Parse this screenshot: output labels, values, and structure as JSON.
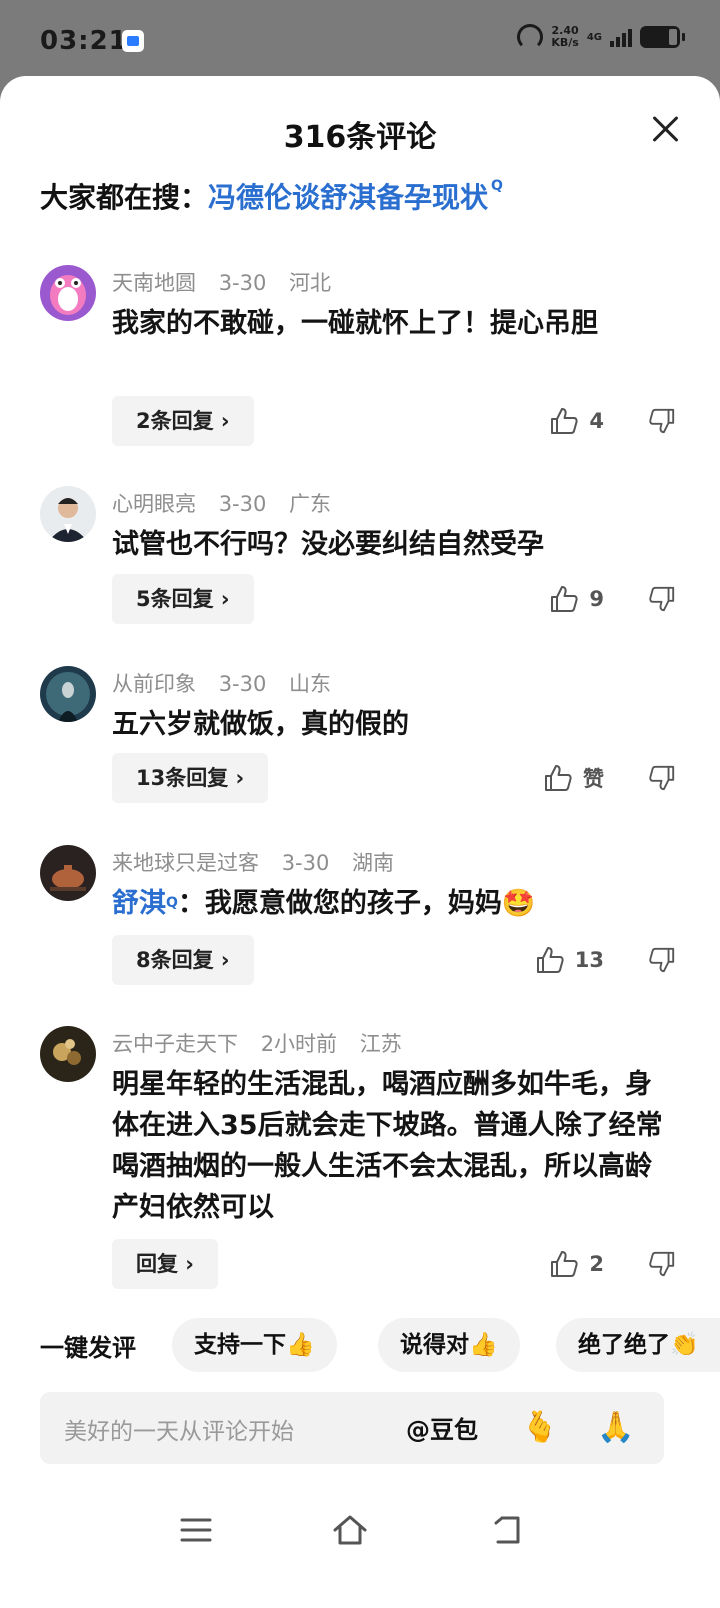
{
  "status_bar": {
    "time": "03:21",
    "speed_value": "2.40",
    "speed_unit": "KB/s",
    "network": "4G",
    "battery_level": 0.3
  },
  "sheet": {
    "title": "316条评论",
    "search_hint_prefix": "大家都在搜：",
    "search_hint_query": "冯德伦谈舒淇备孕现状",
    "search_sup": "Q"
  },
  "comments": [
    {
      "user": "天南地圆",
      "date": "3-30",
      "region": "河北",
      "text": "我家的不敢碰，一碰就怀上了！提心吊胆",
      "replies": "2条回复",
      "likes": "4"
    },
    {
      "user": "心明眼亮",
      "date": "3-30",
      "region": "广东",
      "text": "试管也不行吗？没必要纠结自然受孕",
      "replies": "5条回复",
      "likes": "9"
    },
    {
      "user": "从前印象",
      "date": "3-30",
      "region": "山东",
      "text": "五六岁就做饭，真的假的",
      "replies": "13条回复",
      "likes": "赞"
    },
    {
      "user": "来地球只是过客",
      "date": "3-30",
      "region": "湖南",
      "mention": "舒淇",
      "mention_sup": "Q",
      "text": "：我愿意做您的孩子，妈妈",
      "emoji": "🤩",
      "replies": "8条回复",
      "likes": "13"
    },
    {
      "user": "云中子走天下",
      "date": "2小时前",
      "region": "江苏",
      "text": "明星年轻的生活混乱，喝酒应酬多如牛毛，身体在进入35后就会走下坡路。普通人除了经常喝酒抽烟的一般人生活不会太混乱，所以高龄产妇依然可以",
      "replies": "回复",
      "likes": "2"
    }
  ],
  "quick_reply": {
    "label": "一键发评",
    "chips": [
      "支持一下👍",
      "说得对👍",
      "绝了绝了👏"
    ]
  },
  "input": {
    "placeholder": "美好的一天从评论开始",
    "at_label": "@豆包",
    "emoji_1": "🫰",
    "emoji_2": "🙏"
  },
  "colors": {
    "accent_blue": "#2a6fd0",
    "meta_gray": "#8e8e8e",
    "chip_bg": "#f2f2f2"
  }
}
